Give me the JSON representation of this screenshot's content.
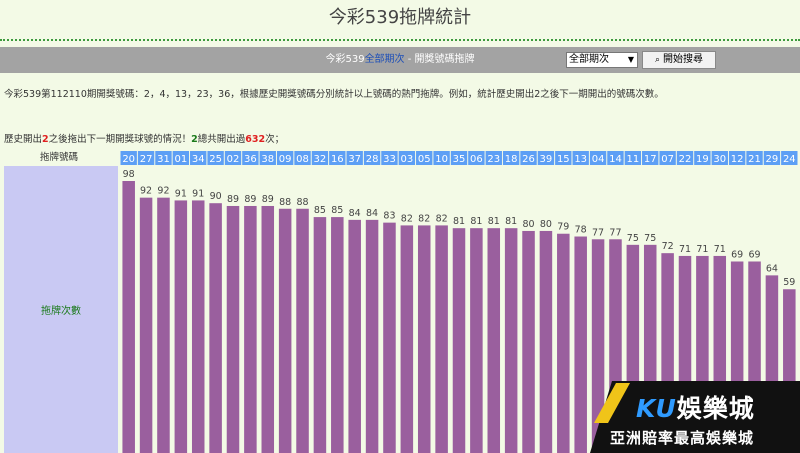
{
  "page": {
    "title": "今彩539拖牌統計",
    "filter_bar": {
      "text_before": "今彩539",
      "link": "全部期次",
      "text_after": " - 開獎號碼拖牌",
      "select_value": "全部期次",
      "search_button": "開始搜尋"
    },
    "info_line": "今彩539第112110期開獎號碼：2，4，13，23，36，根據歷史開獎號碼分別統計以上號碼的熱門拖牌。例如，統計歷史開出2之後下一期開出的號碼次數。",
    "stats": {
      "part1": "歷史開出",
      "number": "2",
      "part2": "之後拖出下一期開獎球號的情況！",
      "count": "2",
      "part3": "總共開出過",
      "total": "632",
      "part4": "次；"
    },
    "header_label": "拖牌號碼",
    "row_label": "拖牌次數"
  },
  "watermark": {
    "brand_latin": "KU",
    "brand_chinese": "娛樂城",
    "slogan": "亞洲賠率最高娛樂城"
  },
  "colors": {
    "bar": "#9a5f9e",
    "header_cell": "#5d9ff5",
    "row_label_bg": "#c9c9f3",
    "page_bg": "#f3fae6"
  },
  "chart_data": {
    "type": "bar",
    "xlabel": "拖牌號碼",
    "ylabel": "拖牌次數",
    "categories": [
      "20",
      "27",
      "31",
      "01",
      "34",
      "25",
      "02",
      "36",
      "38",
      "09",
      "08",
      "32",
      "16",
      "37",
      "28",
      "33",
      "03",
      "05",
      "10",
      "35",
      "06",
      "23",
      "18",
      "26",
      "39",
      "15",
      "13",
      "04",
      "14",
      "11",
      "17",
      "07",
      "22",
      "19",
      "30",
      "12",
      "21",
      "29",
      "24"
    ],
    "values": [
      98,
      92,
      92,
      91,
      91,
      90,
      89,
      89,
      89,
      88,
      88,
      85,
      85,
      84,
      84,
      83,
      82,
      82,
      82,
      81,
      81,
      81,
      81,
      80,
      80,
      79,
      78,
      77,
      77,
      75,
      75,
      72,
      71,
      71,
      71,
      69,
      69,
      64,
      59
    ],
    "ylim": [
      0,
      98
    ]
  }
}
